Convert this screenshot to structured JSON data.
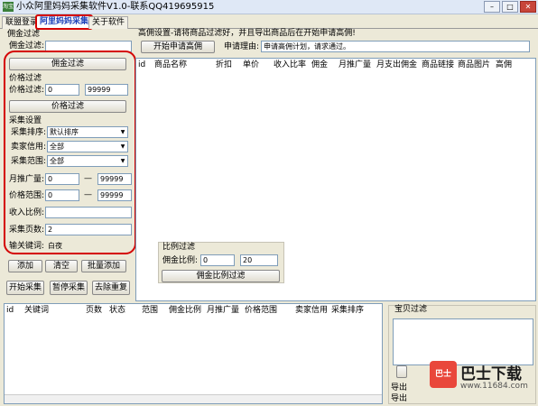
{
  "window": {
    "title": "小众阿里妈妈采集软件V1.0-联系QQ419695915",
    "icon_label": "淘宝",
    "buttons": [
      "–",
      "□",
      "✕"
    ]
  },
  "tabs": [
    {
      "label": "联盟登录"
    },
    {
      "label": "阿里妈妈采集"
    },
    {
      "label": "关于软件"
    }
  ],
  "left": {
    "commission_filter_title": "佣金过滤",
    "commission_label": "佣金过滤:",
    "commission_value": "",
    "commission_filter_button": "佣金过滤",
    "price_filter_title": "价格过滤",
    "price_label": "价格过滤:",
    "price_min": "0",
    "price_max": "99999",
    "price_filter_button": "价格过滤",
    "collect_settings_title": "采集设置",
    "sort_label": "采集排序:",
    "sort_value": "默认排序",
    "credit_label": "卖家信用:",
    "credit_value": "全部",
    "range_label": "采集范围:",
    "range_value": "全部",
    "monthly_label": "月推广量:",
    "monthly_min": "0",
    "monthly_max": "99999",
    "price_range_label": "价格范围:",
    "price_range_min": "0",
    "price_range_max": "99999",
    "income_label": "收入比例:",
    "income_value": "",
    "pages_label": "采集页数:",
    "pages_value": "2",
    "keyword_label": "输关键词:",
    "keyword_value": "白夜",
    "dash": "—",
    "add_button": "添加",
    "clear_button": "清空",
    "batch_add_button": "批量添加",
    "start_button": "开始采集",
    "pause_button": "暂停采集",
    "dedupe_button": "去除重复"
  },
  "right": {
    "hint": "高佣设置-请将商品过滤好，并且导出商品后在开始申请高佣!",
    "apply_button": "开始申请高佣",
    "reason_label": "申请理由:",
    "reason_value": "申请高佣计划，请求通过。",
    "columns": [
      "id",
      "商品名称",
      "折扣",
      "单价",
      "收入比率",
      "佣金",
      "月推广量",
      "月支出佣金",
      "商品链接",
      "商品图片",
      "高佣"
    ],
    "ratio_filter_title": "比例过滤",
    "ratio_label": "佣金比例:",
    "ratio_min": "0",
    "ratio_max": "20",
    "ratio_button": "佣金比例过滤"
  },
  "bottom": {
    "columns": [
      "id",
      "关键词",
      "页数",
      "状态",
      "范围",
      "佣金比例",
      "月推广量",
      "价格范围",
      "卖家信用",
      "采集排序"
    ],
    "baobei_filter_title": "宝贝过滤",
    "export_label_1": "导出",
    "export_label_2": "导出"
  },
  "watermark": {
    "badge": "巴士",
    "text": "巴士下载",
    "url": "www.11684.com"
  }
}
